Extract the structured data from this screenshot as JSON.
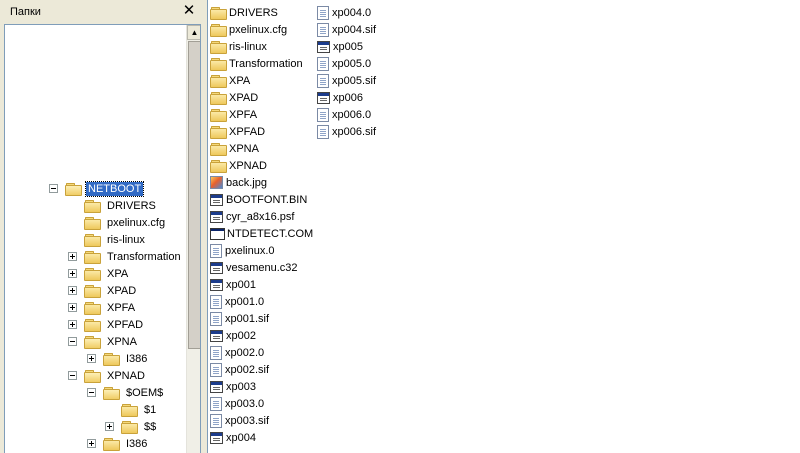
{
  "folders_pane": {
    "title": "Папки",
    "close_glyph": "✕",
    "scroll_up_glyph": "▲",
    "tree": [
      {
        "label": "NETBOOT",
        "level": 0,
        "expander": "minus",
        "open": true,
        "selected": true
      },
      {
        "label": "DRIVERS",
        "level": 1,
        "expander": "none"
      },
      {
        "label": "pxelinux.cfg",
        "level": 1,
        "expander": "none"
      },
      {
        "label": "ris-linux",
        "level": 1,
        "expander": "none"
      },
      {
        "label": "Transformation",
        "level": 1,
        "expander": "plus"
      },
      {
        "label": "XPA",
        "level": 1,
        "expander": "plus"
      },
      {
        "label": "XPAD",
        "level": 1,
        "expander": "plus"
      },
      {
        "label": "XPFA",
        "level": 1,
        "expander": "plus"
      },
      {
        "label": "XPFAD",
        "level": 1,
        "expander": "plus"
      },
      {
        "label": "XPNA",
        "level": 1,
        "expander": "minus",
        "open": true
      },
      {
        "label": "I386",
        "level": 2,
        "expander": "plus"
      },
      {
        "label": "XPNAD",
        "level": 1,
        "expander": "minus",
        "open": true
      },
      {
        "label": "$OEM$",
        "level": 2,
        "expander": "minus",
        "open": true
      },
      {
        "label": "$1",
        "level": 3,
        "expander": "none"
      },
      {
        "label": "$$",
        "level": 3,
        "expander": "plus"
      },
      {
        "label": "I386",
        "level": 2,
        "expander": "plus"
      }
    ]
  },
  "file_list": {
    "columns": [
      [
        {
          "name": "DRIVERS",
          "icon": "folder-icon"
        },
        {
          "name": "pxelinux.cfg",
          "icon": "folder-icon"
        },
        {
          "name": "ris-linux",
          "icon": "folder-icon"
        },
        {
          "name": "Transformation",
          "icon": "folder-icon"
        },
        {
          "name": "XPA",
          "icon": "folder-icon"
        },
        {
          "name": "XPAD",
          "icon": "folder-icon"
        },
        {
          "name": "XPFA",
          "icon": "folder-icon"
        },
        {
          "name": "XPFAD",
          "icon": "folder-icon"
        },
        {
          "name": "XPNA",
          "icon": "folder-icon"
        },
        {
          "name": "XPNAD",
          "icon": "folder-icon"
        },
        {
          "name": "back.jpg",
          "icon": "image-file-icon"
        },
        {
          "name": "BOOTFONT.BIN",
          "icon": "executable-file-icon"
        },
        {
          "name": "cyr_a8x16.psf",
          "icon": "executable-file-icon"
        },
        {
          "name": "NTDETECT.COM",
          "icon": "com-file-icon"
        },
        {
          "name": "pxelinux.0",
          "icon": "document-file-icon"
        },
        {
          "name": "vesamenu.c32",
          "icon": "executable-file-icon"
        },
        {
          "name": "xp001",
          "icon": "executable-file-icon"
        },
        {
          "name": "xp001.0",
          "icon": "document-file-icon"
        },
        {
          "name": "xp001.sif",
          "icon": "document-file-icon"
        },
        {
          "name": "xp002",
          "icon": "executable-file-icon"
        },
        {
          "name": "xp002.0",
          "icon": "document-file-icon"
        },
        {
          "name": "xp002.sif",
          "icon": "document-file-icon"
        },
        {
          "name": "xp003",
          "icon": "executable-file-icon"
        },
        {
          "name": "xp003.0",
          "icon": "document-file-icon"
        },
        {
          "name": "xp003.sif",
          "icon": "document-file-icon"
        },
        {
          "name": "xp004",
          "icon": "executable-file-icon"
        }
      ],
      [
        {
          "name": "xp004.0",
          "icon": "document-file-icon"
        },
        {
          "name": "xp004.sif",
          "icon": "document-file-icon"
        },
        {
          "name": "xp005",
          "icon": "executable-file-icon"
        },
        {
          "name": "xp005.0",
          "icon": "document-file-icon"
        },
        {
          "name": "xp005.sif",
          "icon": "document-file-icon"
        },
        {
          "name": "xp006",
          "icon": "executable-file-icon"
        },
        {
          "name": "xp006.0",
          "icon": "document-file-icon"
        },
        {
          "name": "xp006.sif",
          "icon": "document-file-icon"
        }
      ]
    ]
  }
}
